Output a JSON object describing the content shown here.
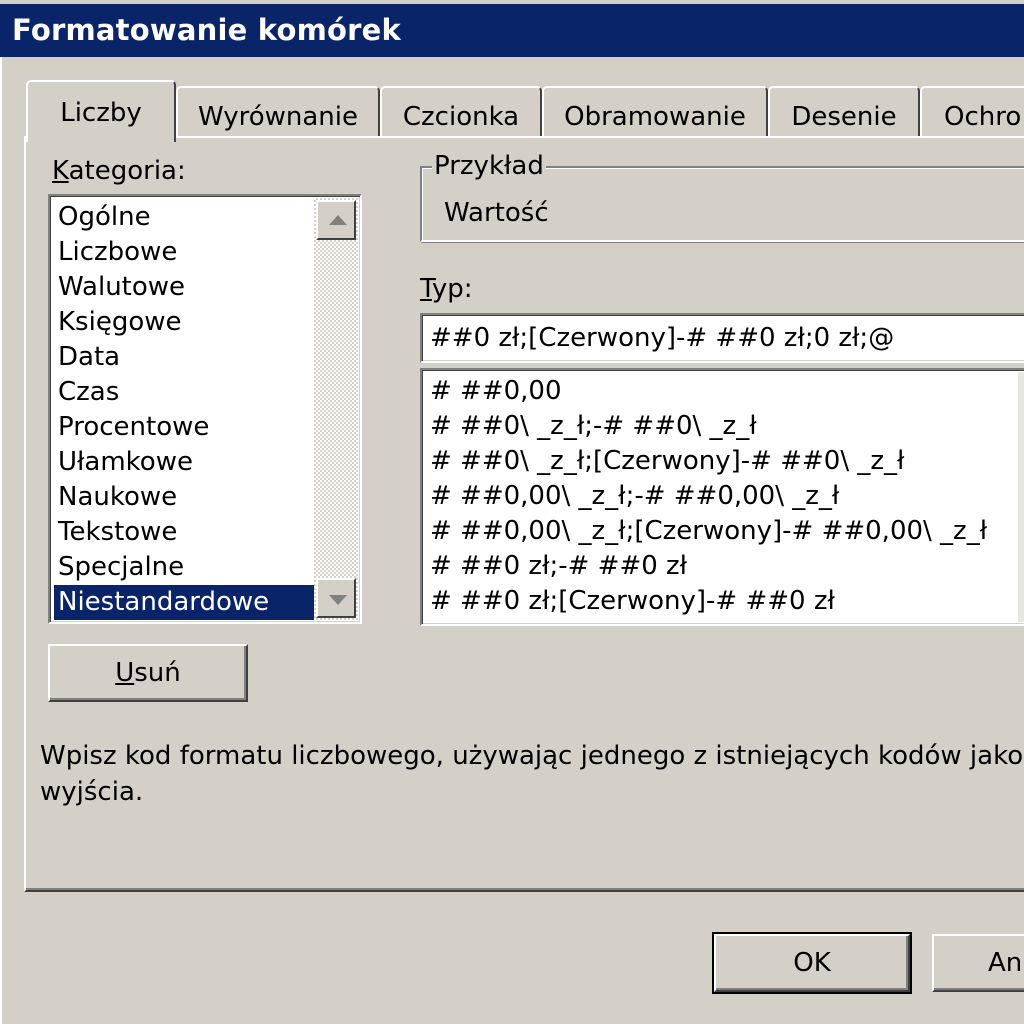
{
  "window": {
    "title": "Formatowanie komórek"
  },
  "tabs": [
    {
      "label": "Liczby",
      "active": true
    },
    {
      "label": "Wyrównanie",
      "active": false
    },
    {
      "label": "Czcionka",
      "active": false
    },
    {
      "label": "Obramowanie",
      "active": false
    },
    {
      "label": "Desenie",
      "active": false
    },
    {
      "label": "Ochro",
      "active": false
    }
  ],
  "category": {
    "label_ul": "K",
    "label_rest": "ategoria:",
    "items": [
      "Ogólne",
      "Liczbowe",
      "Walutowe",
      "Księgowe",
      "Data",
      "Czas",
      "Procentowe",
      "Ułamkowe",
      "Naukowe",
      "Tekstowe",
      "Specjalne",
      "Niestandardowe"
    ],
    "selected": "Niestandardowe"
  },
  "sample": {
    "legend": "Przykład",
    "value": "Wartość"
  },
  "type": {
    "label_ul": "T",
    "label_rest": "yp:",
    "value": "##0 zł;[Czerwony]-# ##0 zł;0 zł;@",
    "items": [
      "# ##0,00",
      "# ##0\\ _z_ł;-# ##0\\ _z_ł",
      "# ##0\\ _z_ł;[Czerwony]-# ##0\\ _z_ł",
      "# ##0,00\\ _z_ł;-# ##0,00\\ _z_ł",
      "# ##0,00\\ _z_ł;[Czerwony]-# ##0,00\\ _z_ł",
      "# ##0 zł;-# ##0 zł",
      "# ##0 zł;[Czerwony]-# ##0 zł"
    ]
  },
  "delete_button": {
    "label_ul": "U",
    "label_rest": "suń"
  },
  "description": {
    "line1": "Wpisz kod formatu liczbowego, używając jednego z istniejących kodów jako",
    "line2": "wyjścia."
  },
  "footer": {
    "ok_label": "OK",
    "cancel_label": "An"
  },
  "colors": {
    "title_bar": "#0a246a",
    "selection": "#0a246a",
    "dialog_face": "#d4d0c8"
  }
}
